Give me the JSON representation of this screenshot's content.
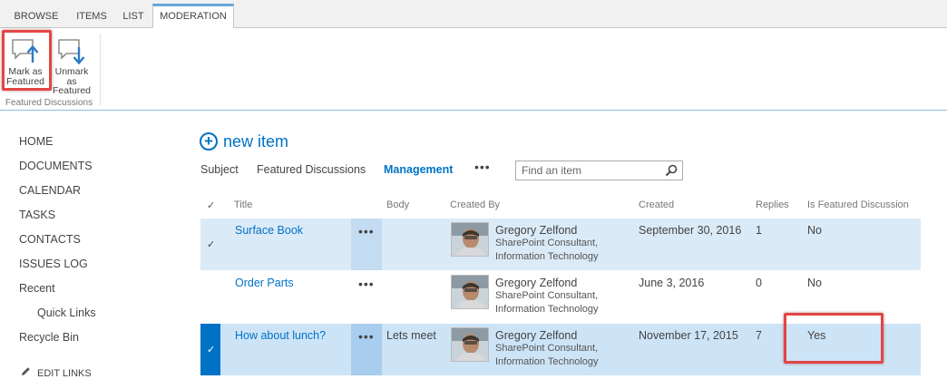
{
  "ribbon": {
    "tabs": [
      "BROWSE",
      "ITEMS",
      "LIST",
      "MODERATION"
    ],
    "active_tab": "MODERATION",
    "buttons": [
      {
        "label_line1": "Mark as",
        "label_line2": "Featured",
        "icon": "mark-featured-icon"
      },
      {
        "label_line1": "Unmark as",
        "label_line2": "Featured",
        "icon": "unmark-featured-icon"
      }
    ],
    "group_label": "Featured Discussions"
  },
  "nav": {
    "items": [
      "HOME",
      "DOCUMENTS",
      "CALENDAR",
      "TASKS",
      "CONTACTS",
      "ISSUES LOG",
      "Recent",
      "Quick Links",
      "Recycle Bin"
    ],
    "edit_links": "EDIT LINKS"
  },
  "main": {
    "new_item": "new item",
    "views": [
      "Subject",
      "Featured Discussions",
      "Management"
    ],
    "selected_view": "Management",
    "more_views": "•••",
    "search_placeholder": "Find an item"
  },
  "table": {
    "headers": {
      "check": "✓",
      "title": "Title",
      "body": "Body",
      "created_by": "Created By",
      "created": "Created",
      "replies": "Replies",
      "featured": "Is Featured Discussion"
    },
    "rows": [
      {
        "title": "Surface Book",
        "menu": "•••",
        "body": "",
        "author": "Gregory Zelfond",
        "author_title": "SharePoint Consultant,",
        "author_dept": "Information Technology",
        "created": "September 30, 2016",
        "replies": "1",
        "featured": "No",
        "check": "✓"
      },
      {
        "title": "Order Parts",
        "menu": "•••",
        "body": "",
        "author": "Gregory Zelfond",
        "author_title": "SharePoint Consultant,",
        "author_dept": "Information Technology",
        "created": "June 3, 2016",
        "replies": "0",
        "featured": "No",
        "check": ""
      },
      {
        "title": "How about lunch?",
        "menu": "•••",
        "body": "Lets meet",
        "author": "Gregory Zelfond",
        "author_title": "SharePoint Consultant,",
        "author_dept": "Information Technology",
        "created": "November 17, 2015",
        "replies": "7",
        "featured": "Yes",
        "check": "✓"
      }
    ]
  },
  "colors": {
    "accent": "#0072c6",
    "highlight_box": "#e24646",
    "selected_row": "#dbeaf7"
  }
}
